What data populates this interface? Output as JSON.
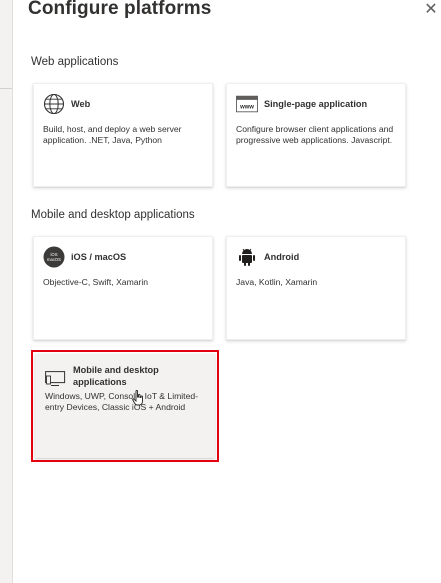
{
  "panel": {
    "title": "Configure platforms",
    "close_label": "✕"
  },
  "sections": [
    {
      "title": "Web applications",
      "cards": [
        {
          "name": "Web",
          "icon": "globe-icon",
          "description": "Build, host, and deploy a web server application. .NET, Java, Python"
        },
        {
          "name": "Single-page application",
          "icon": "www-icon",
          "description": "Configure browser client applications and progressive web applications. Javascript."
        }
      ]
    },
    {
      "title": "Mobile and desktop applications",
      "cards": [
        {
          "name": "iOS / macOS",
          "icon": "ios-macos-icon",
          "description": "Objective-C, Swift, Xamarin"
        },
        {
          "name": "Android",
          "icon": "android-icon",
          "description": "Java, Kotlin, Xamarin"
        },
        {
          "name": "Mobile and desktop applications",
          "icon": "desktop-mobile-icon",
          "description": "Windows, UWP, Console, IoT & Limited-entry Devices, Classic iOS + Android",
          "selected": true
        }
      ]
    }
  ],
  "ios_badge_text": "iOS\nmacOS",
  "colors": {
    "accent_highlight": "#e3000f",
    "text": "#323130",
    "card_selected_bg": "#f3f2f1"
  }
}
